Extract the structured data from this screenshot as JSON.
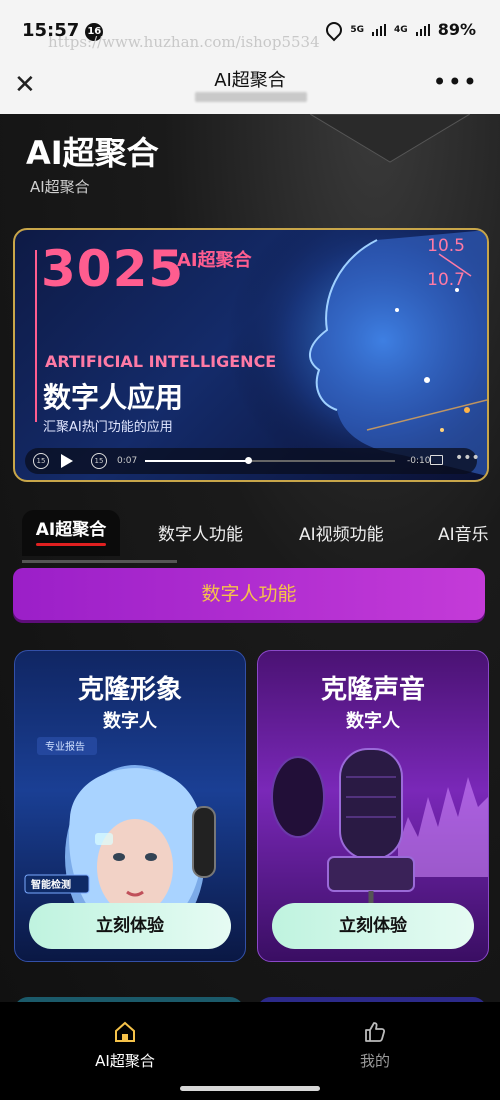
{
  "status": {
    "time": "15:57",
    "notification_count": "16",
    "url_watermark": "https://www.huzhan.com/ishop5534",
    "signal1": "5G",
    "signal2": "4G",
    "battery": "89%"
  },
  "navbar": {
    "title": "AI超聚合",
    "close_icon": "close-icon",
    "more_icon": "more-icon"
  },
  "hero": {
    "title": "AI超聚合",
    "subtitle": "AI超聚合"
  },
  "video": {
    "year": "3025",
    "ai_label": "AI超聚合",
    "date_start": "10.5",
    "date_end": "10.7",
    "eyebrow": "ARTIFICIAL INTELLIGENCE",
    "headline": "数字人应用",
    "caption": "汇聚AI热门功能的应用",
    "current_time": "0:07",
    "remaining_time": "-0:10",
    "progress": 0.41
  },
  "tabs": [
    {
      "label": "AI超聚合",
      "active": true
    },
    {
      "label": "数字人功能",
      "active": false
    },
    {
      "label": "AI视频功能",
      "active": false
    },
    {
      "label": "AI音乐",
      "active": false
    }
  ],
  "section": {
    "label": "数字人功能"
  },
  "cards": [
    {
      "title": "克隆形象",
      "subtitle": "数字人",
      "button": "立刻体验",
      "tag": "智能检测",
      "tag2": "专业报告"
    },
    {
      "title": "克隆声音",
      "subtitle": "数字人",
      "button": "立刻体验"
    }
  ],
  "bottom_nav": [
    {
      "label": "AI超聚合",
      "icon": "home-icon",
      "active": true
    },
    {
      "label": "我的",
      "icon": "thumbs-up-icon",
      "active": false
    }
  ],
  "colors": {
    "accent_pink": "#ff5d8f",
    "section_gold": "#f5c24a",
    "section_purple": "#9b1fc8",
    "tab_underline": "#e02020"
  }
}
